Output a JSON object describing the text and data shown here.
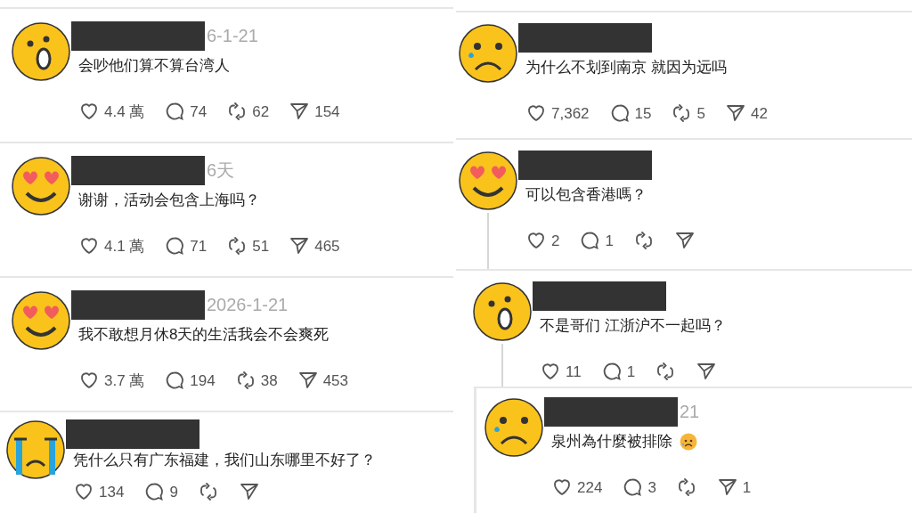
{
  "left_column": {
    "comments": [
      {
        "kind": "shocked",
        "time": "6-1-21",
        "text": "会吵他们算不算台湾人",
        "likes": "4.4 萬",
        "replies": "74",
        "reposts": "62",
        "shares": "154"
      },
      {
        "kind": "hearts",
        "time": "6天",
        "text": "谢谢，活动会包含上海吗？",
        "likes": "4.1 萬",
        "replies": "71",
        "reposts": "51",
        "shares": "465"
      },
      {
        "kind": "hearts",
        "time": "2026-1-21",
        "text": "我不敢想月休8天的生活我会不会爽死",
        "likes": "3.7 萬",
        "replies": "194",
        "reposts": "38",
        "shares": "453"
      },
      {
        "kind": "crying",
        "text": "凭什么只有广东福建，我们山东哪里不好了？",
        "likes": "134",
        "replies": "9"
      }
    ]
  },
  "right_column": {
    "comments": [
      {
        "kind": "sad_tear",
        "text": "为什么不划到南京 就因为远吗",
        "likes": "7,362",
        "replies": "15",
        "reposts": "5",
        "shares": "42"
      },
      {
        "kind": "hearts",
        "text": "可以包含香港嗎？",
        "likes": "2",
        "replies": "1",
        "thread_line": true
      },
      {
        "kind": "shocked",
        "text": "不是哥们 江浙沪不一起吗？",
        "likes": "11",
        "replies": "1",
        "thread_line": true
      },
      {
        "kind": "sad_tear",
        "time": "21",
        "text": "泉州為什麼被排除",
        "likes": "224",
        "replies": "3",
        "shares": "1",
        "indented": true,
        "emoji": true
      }
    ]
  }
}
